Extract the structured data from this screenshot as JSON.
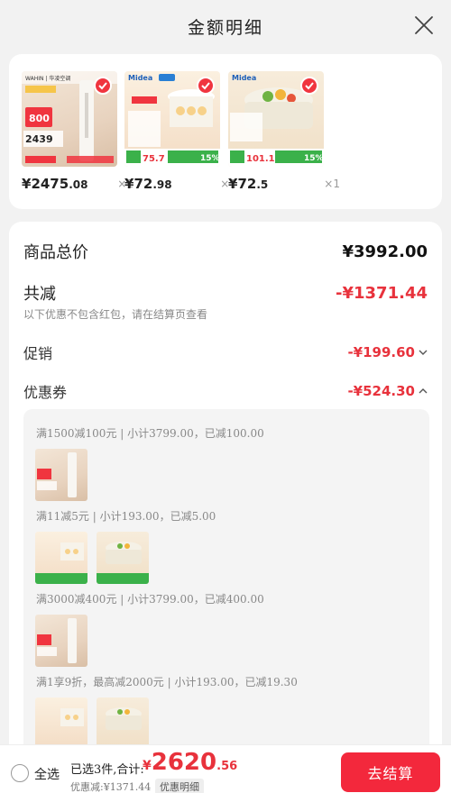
{
  "header": {
    "title": "金额明细"
  },
  "products": [
    {
      "price_yen": "¥",
      "price_int": "2475",
      "price_dec": ".08",
      "qty": "×1",
      "brand": "WAHIN | 华凌空调",
      "badge": "800",
      "tag_price": "2439"
    },
    {
      "price_yen": "¥",
      "price_int": "72",
      "price_dec": ".98",
      "qty": "×1",
      "brand": "Midea",
      "tag_price": "75.7",
      "pct": "15%"
    },
    {
      "price_yen": "¥",
      "price_int": "72",
      "price_dec": ".5",
      "qty": "×1",
      "brand": "Midea",
      "tag_price": "101.19",
      "pct": "15%"
    }
  ],
  "details": {
    "total_label": "商品总价",
    "total_value": "¥3992.00",
    "reduce_label": "共减",
    "reduce_value": "-¥1371.44",
    "note": "以下优惠不包含红包，请在结算页查看",
    "promo_label": "促销",
    "promo_value": "-¥199.60",
    "coupon_label": "优惠券",
    "coupon_value": "-¥524.30"
  },
  "coupon_groups": [
    {
      "title": "满1500减100元 | 小计3799.00，已减100.00"
    },
    {
      "title": "满11减5元 | 小计193.00，已减5.00"
    },
    {
      "title": "满3000减400元 | 小计3799.00，已减400.00"
    },
    {
      "title": "满1享9折，最高减2000元 | 小计193.00，已减19.30"
    }
  ],
  "bottom": {
    "select_all": "全选",
    "summary": "已选3件,合计:",
    "total_yen": "¥",
    "total_int": "2620",
    "total_dec": ".56",
    "discount": "优惠减:¥1371.44",
    "detail_link": "优惠明细",
    "checkout": "去结算"
  },
  "colors": {
    "accent": "#f3283c",
    "price_red": "#e8323c"
  }
}
